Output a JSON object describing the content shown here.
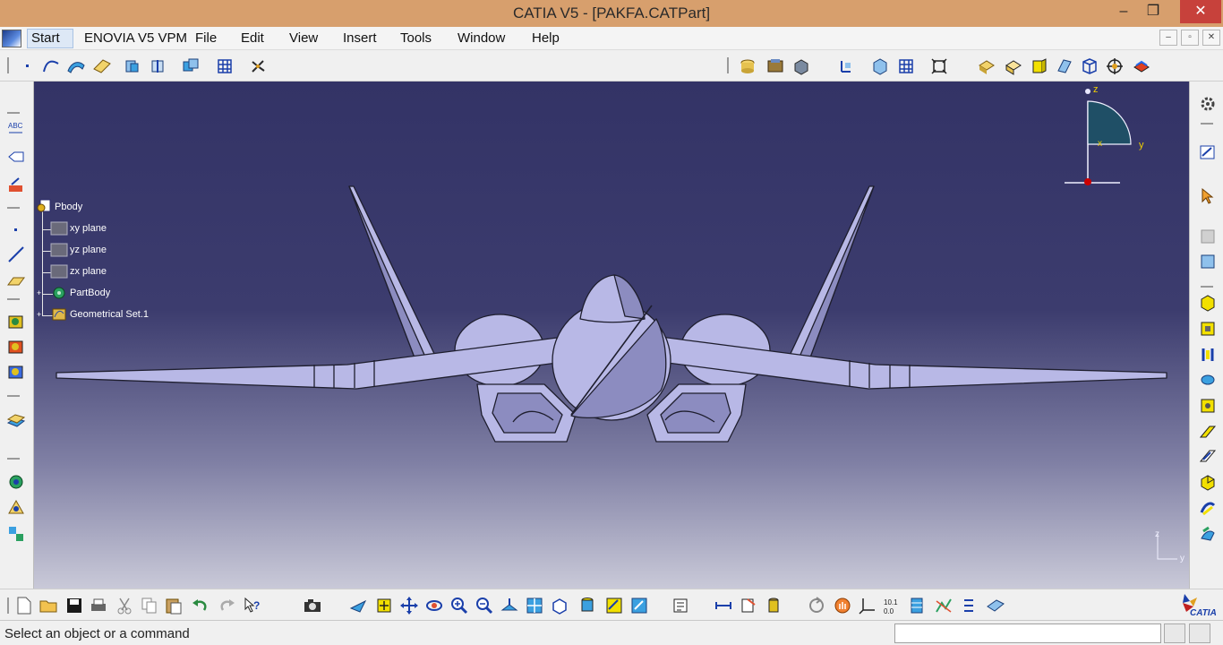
{
  "window": {
    "title": "CATIA V5 - [PAKFA.CATPart]",
    "controls": {
      "minimize": "‒",
      "maximize": "❐",
      "close": "✕"
    }
  },
  "menubar": {
    "items": [
      "Start",
      "ENOVIA V5 VPM",
      "File",
      "Edit",
      "View",
      "Insert",
      "Tools",
      "Window",
      "Help"
    ],
    "mdi_controls": [
      "–",
      "▫",
      "✕"
    ]
  },
  "tree": {
    "root": "Pbody",
    "children": [
      "xy plane",
      "yz plane",
      "zx plane",
      "PartBody",
      "Geometrical Set.1"
    ]
  },
  "compass": {
    "axes": [
      "z",
      "y",
      "x"
    ]
  },
  "mini_axis": {
    "axes": [
      "z",
      "y"
    ]
  },
  "statusbar": {
    "message": "Select an object or a command",
    "command_input": ""
  },
  "colors": {
    "titlebar": "#d79f6d",
    "close_button": "#c7413b",
    "viewport_top": "#333366",
    "viewport_bottom": "#c9c9d8",
    "model": "#b8b8e6"
  },
  "brand": {
    "logo_text": "CATIA"
  }
}
